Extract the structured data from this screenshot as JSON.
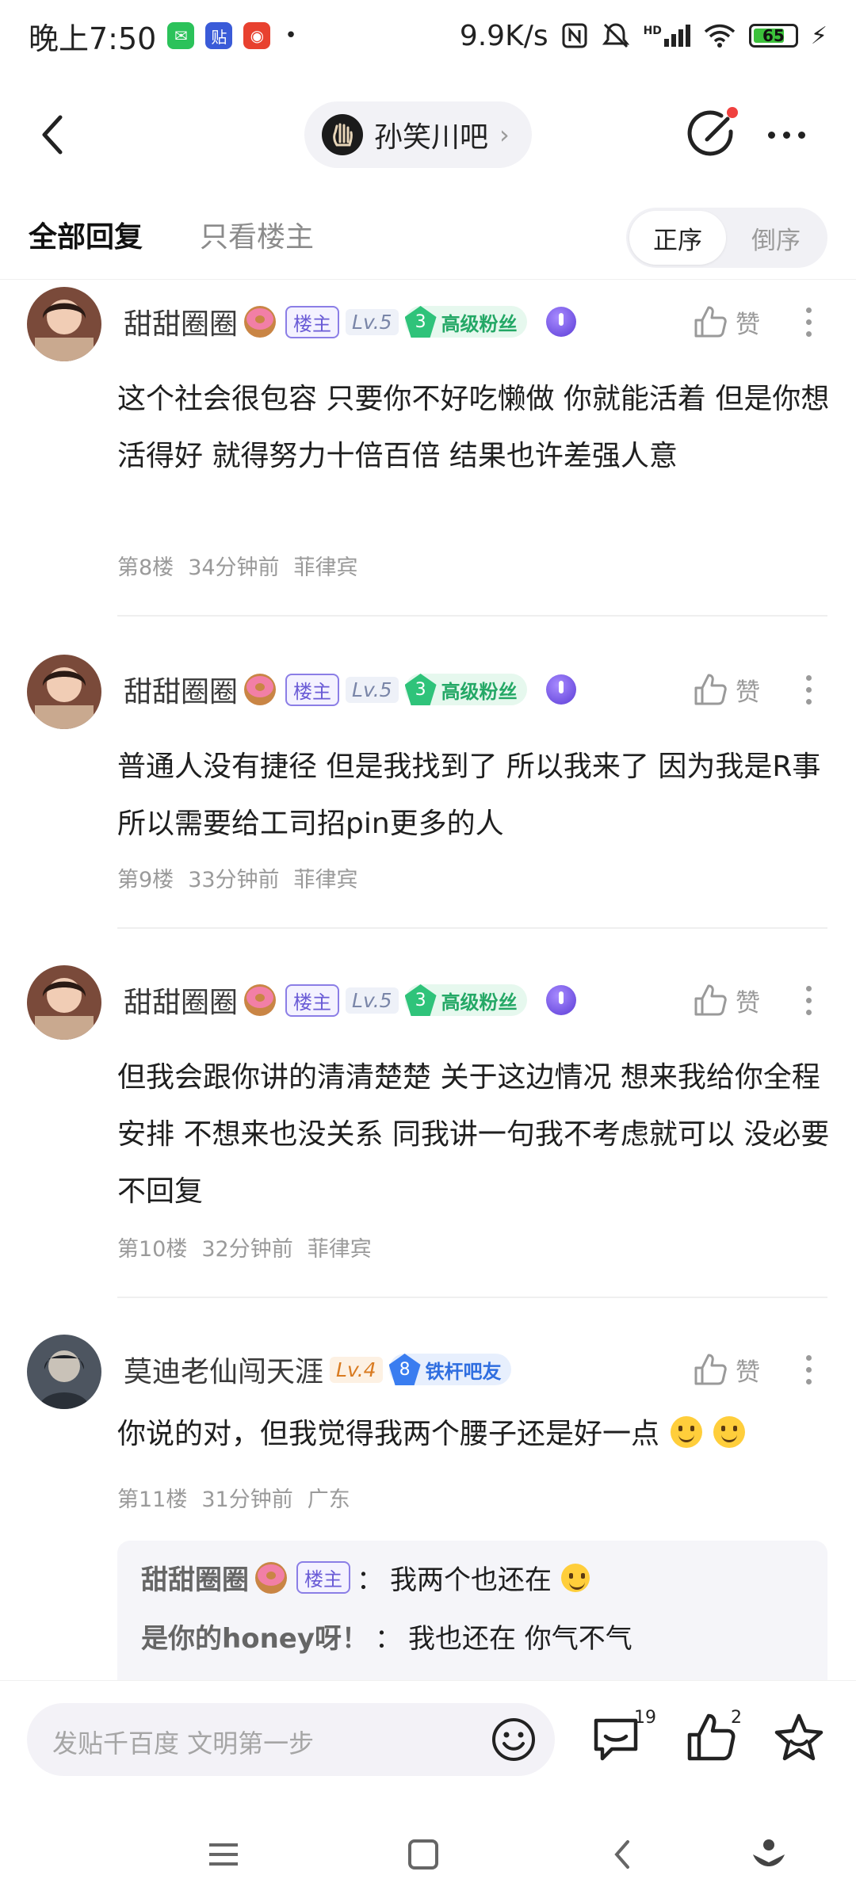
{
  "status_bar": {
    "time": "晚上7:50",
    "net_speed": "9.9K/s",
    "battery": "65",
    "signal_label": "HD"
  },
  "header": {
    "forum_name": "孙笑川吧"
  },
  "tabs": {
    "all": "全部回复",
    "owner_only": "只看楼主",
    "order_asc": "正序",
    "order_desc": "倒序"
  },
  "posts": [
    {
      "username": "甜甜圈圈",
      "owner_badge": "楼主",
      "level": "Lv.5",
      "fan_level": "3",
      "fan_title": "高级粉丝",
      "like_label": "赞",
      "content": "这个社会很包容 只要你不好吃懒做 你就能活着 但是你想活得好 就得努力十倍百倍 结果也许差强人意",
      "floor": "第8楼",
      "time": "34分钟前",
      "location": "菲律宾"
    },
    {
      "username": "甜甜圈圈",
      "owner_badge": "楼主",
      "level": "Lv.5",
      "fan_level": "3",
      "fan_title": "高级粉丝",
      "like_label": "赞",
      "content": "普通人没有捷径 但是我找到了 所以我来了 因为我是R事 所以需要给工司招pin更多的人",
      "floor": "第9楼",
      "time": "33分钟前",
      "location": "菲律宾"
    },
    {
      "username": "甜甜圈圈",
      "owner_badge": "楼主",
      "level": "Lv.5",
      "fan_level": "3",
      "fan_title": "高级粉丝",
      "like_label": "赞",
      "content": "但我会跟你讲的清清楚楚 关于这边情况 想来我给你全程安排 不想来也没关系 同我讲一句我不考虑就可以 没必要不回复",
      "floor": "第10楼",
      "time": "32分钟前",
      "location": "菲律宾"
    },
    {
      "username": "莫迪老仙闯天涯",
      "level": "Lv.4",
      "fan_level": "8",
      "fan_title": "铁杆吧友",
      "like_label": "赞",
      "content": "你说的对，但我觉得我两个腰子还是好一点",
      "floor": "第11楼",
      "time": "31分钟前",
      "location": "广东"
    }
  ],
  "replies": [
    {
      "name": "甜甜圈圈",
      "badge": "楼主",
      "separator": "：",
      "text": "我两个也还在"
    },
    {
      "name": "是你的honey呀！",
      "separator": "：",
      "text": "我也还在 你气不气"
    }
  ],
  "bottom_bar": {
    "input_placeholder": "发贴千百度 文明第一步",
    "comment_count": "19",
    "like_count": "2"
  }
}
